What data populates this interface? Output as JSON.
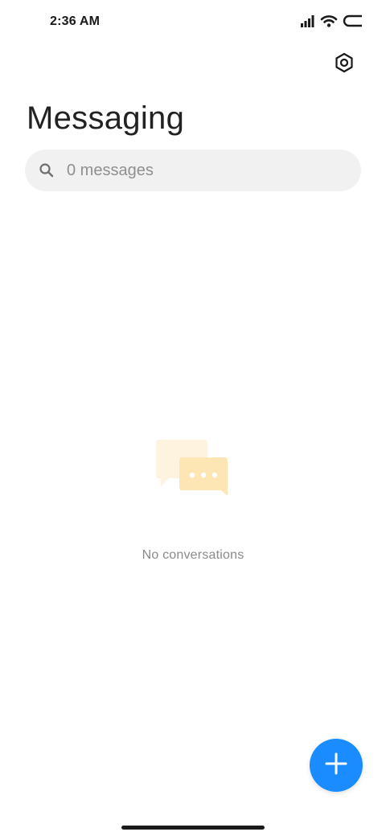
{
  "status_bar": {
    "time": "2:36 AM",
    "icons": [
      "signal-icon",
      "wifi-icon",
      "battery-icon"
    ]
  },
  "header": {
    "title": "Messaging",
    "settings_icon": "settings-icon"
  },
  "search": {
    "placeholder": "0 messages",
    "value": "",
    "icon": "search-icon"
  },
  "empty_state": {
    "illustration": "chat-bubbles-icon",
    "text": "No conversations"
  },
  "fab": {
    "icon": "plus-icon",
    "color": "#1a8cff"
  },
  "colors": {
    "background": "#ffffff",
    "search_bg": "#f1f1f1",
    "accent": "#1a8cff",
    "bubble_back": "#fdf3de",
    "bubble_front": "#fde6b4"
  }
}
